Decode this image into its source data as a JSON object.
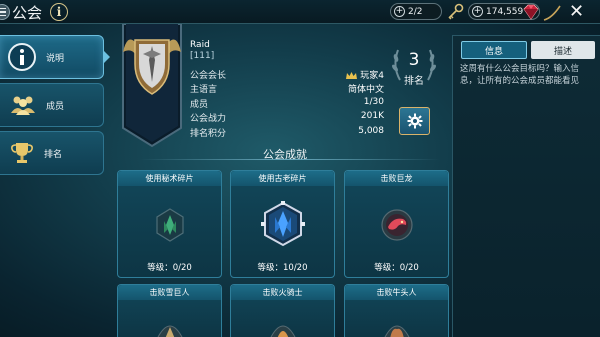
{
  "header": {
    "title": "公会",
    "info_glyph": "i",
    "resource_keys": "2/2",
    "resource_gems": "174,559",
    "close_glyph": "✕",
    "icons": [
      "menu-icon",
      "info-icon",
      "key-icon",
      "gem-icon",
      "close-icon"
    ]
  },
  "sidebar": {
    "items": [
      {
        "label": "说明",
        "icon": "info-icon",
        "active": true
      },
      {
        "label": "成员",
        "icon": "members-icon",
        "active": false
      },
      {
        "label": "排名",
        "icon": "trophy-icon",
        "active": false
      }
    ]
  },
  "guild": {
    "name": "Raid",
    "tag": "[111]",
    "stats": [
      {
        "key": "公会会长",
        "value": "玩家4"
      },
      {
        "key": "主语言",
        "value": "简体中文"
      },
      {
        "key": "成员",
        "value": "1/30"
      },
      {
        "key": "公会战力",
        "value": "201K"
      },
      {
        "key": "排名积分",
        "value": "5,008"
      }
    ],
    "rank_value": "3",
    "rank_label": "排名"
  },
  "right_panel": {
    "tab_info": "信息",
    "tab_desc": "描述",
    "text": "这周有什么公会目标吗？输入信息，让所有的公会成员都能看见"
  },
  "achievements": {
    "title": "公会成就",
    "cards": [
      {
        "title": "使用秘术碎片",
        "level": "等级：0/20",
        "icon": "ancient-shard-icon"
      },
      {
        "title": "使用古老碎片",
        "level": "等级：10/20",
        "icon": "ancient-shard-icon"
      },
      {
        "title": "击败巨龙",
        "level": "等级：0/20",
        "icon": "dragon-icon"
      },
      {
        "title": "击败雪巨人",
        "level": "",
        "icon": "ice-golem-icon"
      },
      {
        "title": "击败火骑士",
        "level": "",
        "icon": "fire-knight-icon"
      },
      {
        "title": "击败牛头人",
        "level": "",
        "icon": "minotaur-icon"
      }
    ]
  },
  "colors": {
    "accent_gold": "#d9b36a",
    "tab_active": "#6cc0e0",
    "background": "#123c4a"
  }
}
